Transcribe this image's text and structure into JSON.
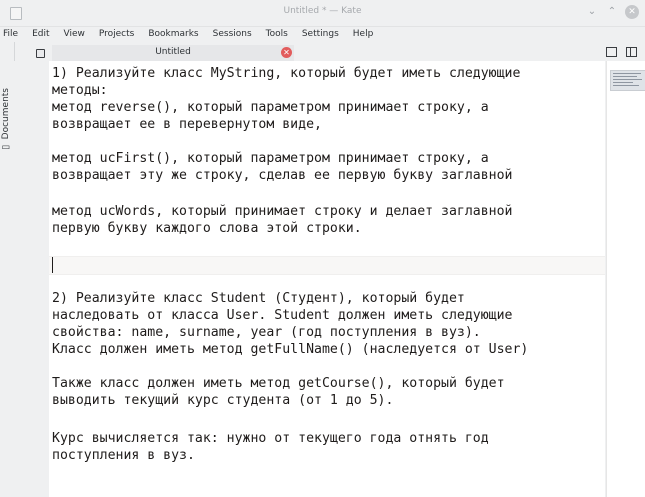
{
  "window": {
    "title": "Untitled * — Kate"
  },
  "menubar": [
    "File",
    "Edit",
    "View",
    "Projects",
    "Bookmarks",
    "Sessions",
    "Tools",
    "Settings",
    "Help"
  ],
  "sidebar": {
    "documents_label": "Documents"
  },
  "tabs": [
    {
      "label": "Untitled",
      "modified": true
    }
  ],
  "icons": {
    "app": "kate-doc-icon",
    "tab_doc": "document-icon",
    "tab_close": "close-icon",
    "split_h": "split-view-icon",
    "split_v": "split-view-vertical-icon"
  },
  "colors": {
    "accent": "#3daee9",
    "close": "#e25c5c"
  },
  "editor": {
    "lines": [
      "1) Реализуйте класс MyString, который будет иметь следующие",
      "методы:",
      "метод reverse(), который параметром принимает строку, а",
      "возвращает ее в перевернутом виде,",
      "",
      "метод ucFirst(), который параметром принимает строку, а",
      "возвращает эту же строку, сделав ее первую букву заглавной",
      "",
      "метод ucWords, который принимает строку и делает заглавной",
      "первую букву каждого слова этой строки.",
      "",
      "",
      "",
      "2) Реализуйте класс Student (Студент), который будет",
      "наследовать от класса User. Student должен иметь следующие",
      "свойства: name, surname, year (год поступления в вуз).",
      "Класс должен иметь метод getFullName() (наследуется от User)",
      "",
      "Также класс должен иметь метод getCourse(), который будет",
      "выводить текущий курс студента (от 1 до 5).",
      "",
      "Курс вычисляется так: нужно от текущего года отнять год",
      "поступления в вуз."
    ],
    "cursor_line": 11
  }
}
